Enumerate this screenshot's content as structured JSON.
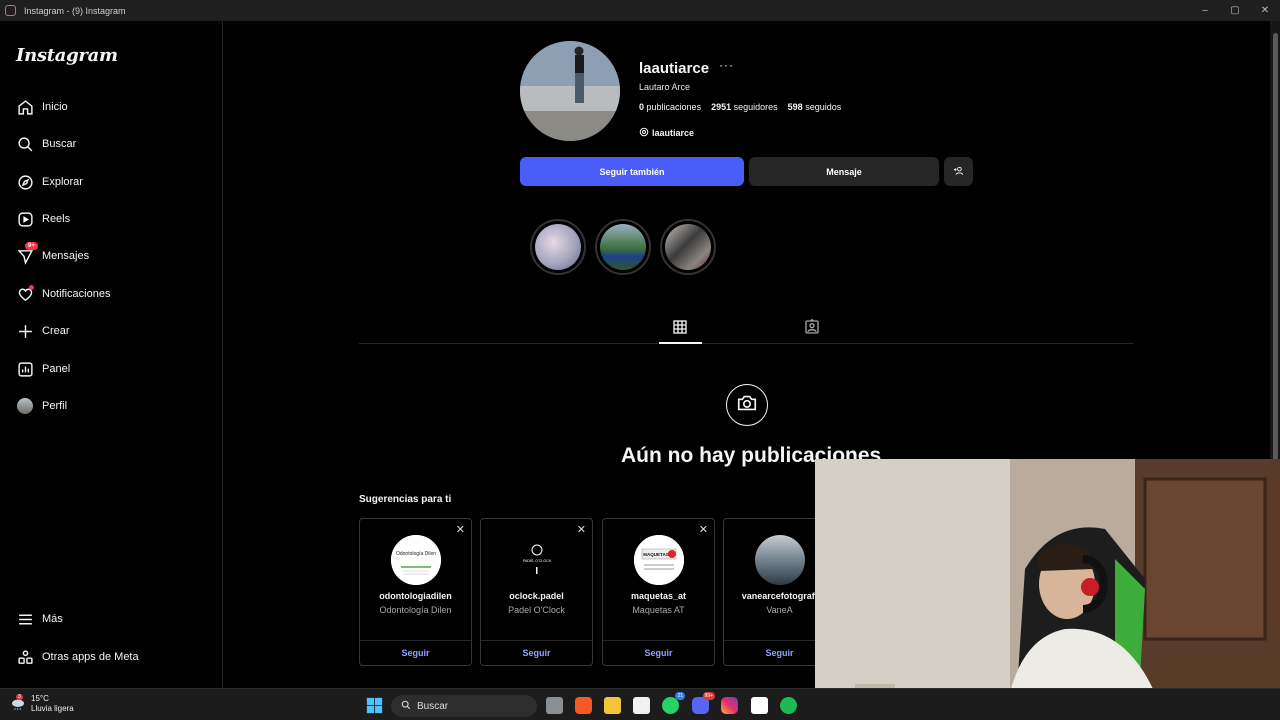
{
  "window": {
    "title": "Instagram - (9) Instagram",
    "controls": [
      "–",
      "▢",
      "✕"
    ]
  },
  "sidebar": {
    "logo": "Instagram",
    "items": [
      {
        "label": "Inicio",
        "icon": "home-icon"
      },
      {
        "label": "Buscar",
        "icon": "search-icon"
      },
      {
        "label": "Explorar",
        "icon": "compass-icon"
      },
      {
        "label": "Reels",
        "icon": "reels-icon"
      },
      {
        "label": "Mensajes",
        "icon": "messenger-icon",
        "badge": "9+"
      },
      {
        "label": "Notificaciones",
        "icon": "heart-icon",
        "dot": true
      },
      {
        "label": "Crear",
        "icon": "plus-icon"
      },
      {
        "label": "Panel",
        "icon": "chart-icon"
      },
      {
        "label": "Perfil",
        "icon": "avatar-icon"
      }
    ],
    "bottom": [
      {
        "label": "Más",
        "icon": "menu-icon"
      },
      {
        "label": "Otras apps de Meta",
        "icon": "meta-apps-icon"
      }
    ]
  },
  "profile": {
    "username": "laautiarce",
    "more": "···",
    "full_name": "Lautaro Arce",
    "posts_count": "0",
    "posts_label": "publicaciones",
    "followers_count": "2951",
    "followers_label": "seguidores",
    "following_count": "598",
    "following_label": "seguidos",
    "threads_handle": "laautiarce",
    "follow_back_label": "Seguir también",
    "message_label": "Mensaje"
  },
  "tabs": {
    "active": "posts-grid"
  },
  "empty_state": {
    "text": "Aún no hay publicaciones"
  },
  "suggestions": {
    "title": "Sugerencias para ti",
    "cards": [
      {
        "username": "odontologiadilen",
        "name": "Odontología Dilen",
        "follow": "Seguir",
        "pic_text": "Odontología Dilen"
      },
      {
        "username": "oclock.padel",
        "name": "Padel O'Clock",
        "follow": "Seguir",
        "pic_text": "PADEL O'CLOCK"
      },
      {
        "username": "maquetas_at",
        "name": "Maquetas AT",
        "follow": "Seguir",
        "pic_text": "MAQUETAS"
      },
      {
        "username": "vanearcefotografi",
        "name": "VaneA",
        "follow": "Seguir",
        "pic_text": ""
      }
    ]
  },
  "taskbar": {
    "temperature": "15°C",
    "weather": "Lluvia ligera",
    "weather_badge": "3",
    "search_placeholder": "Buscar",
    "whatsapp_badge": "21",
    "discord_badge": "99+"
  },
  "colors": {
    "accent": "#4a5df9",
    "badge": "#ff3040",
    "follow_link": "#8fa5ff"
  }
}
